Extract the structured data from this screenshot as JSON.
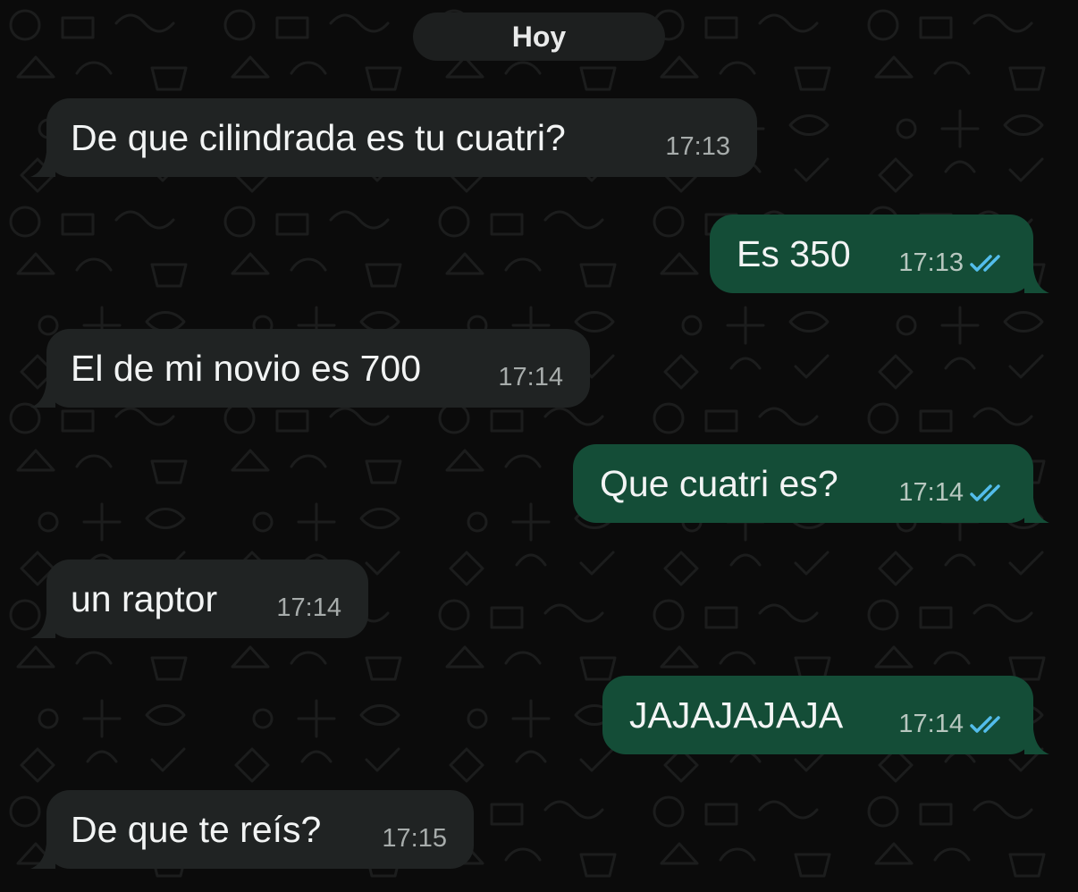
{
  "header": {
    "date_label": "Hoy"
  },
  "messages": [
    {
      "text": "De que cilindrada es tu cuatri?",
      "time": "17:13",
      "direction": "incoming",
      "read": false
    },
    {
      "text": "Es 350",
      "time": "17:13",
      "direction": "outgoing",
      "read": true
    },
    {
      "text": "El de mi novio es 700",
      "time": "17:14",
      "direction": "incoming",
      "read": false
    },
    {
      "text": "Que cuatri es?",
      "time": "17:14",
      "direction": "outgoing",
      "read": true
    },
    {
      "text": "un raptor",
      "time": "17:14",
      "direction": "incoming",
      "read": false
    },
    {
      "text": "JAJAJAJAJA",
      "time": "17:14",
      "direction": "outgoing",
      "read": true
    },
    {
      "text": "De que te reís?",
      "time": "17:15",
      "direction": "incoming",
      "read": false
    }
  ],
  "colors": {
    "background": "#0b0b0b",
    "incoming_bubble": "#202323",
    "outgoing_bubble": "#144d37",
    "read_check": "#53bdeb"
  },
  "icons": {
    "read_receipt": "double-check-icon",
    "wallpaper": "doodle-wallpaper"
  }
}
